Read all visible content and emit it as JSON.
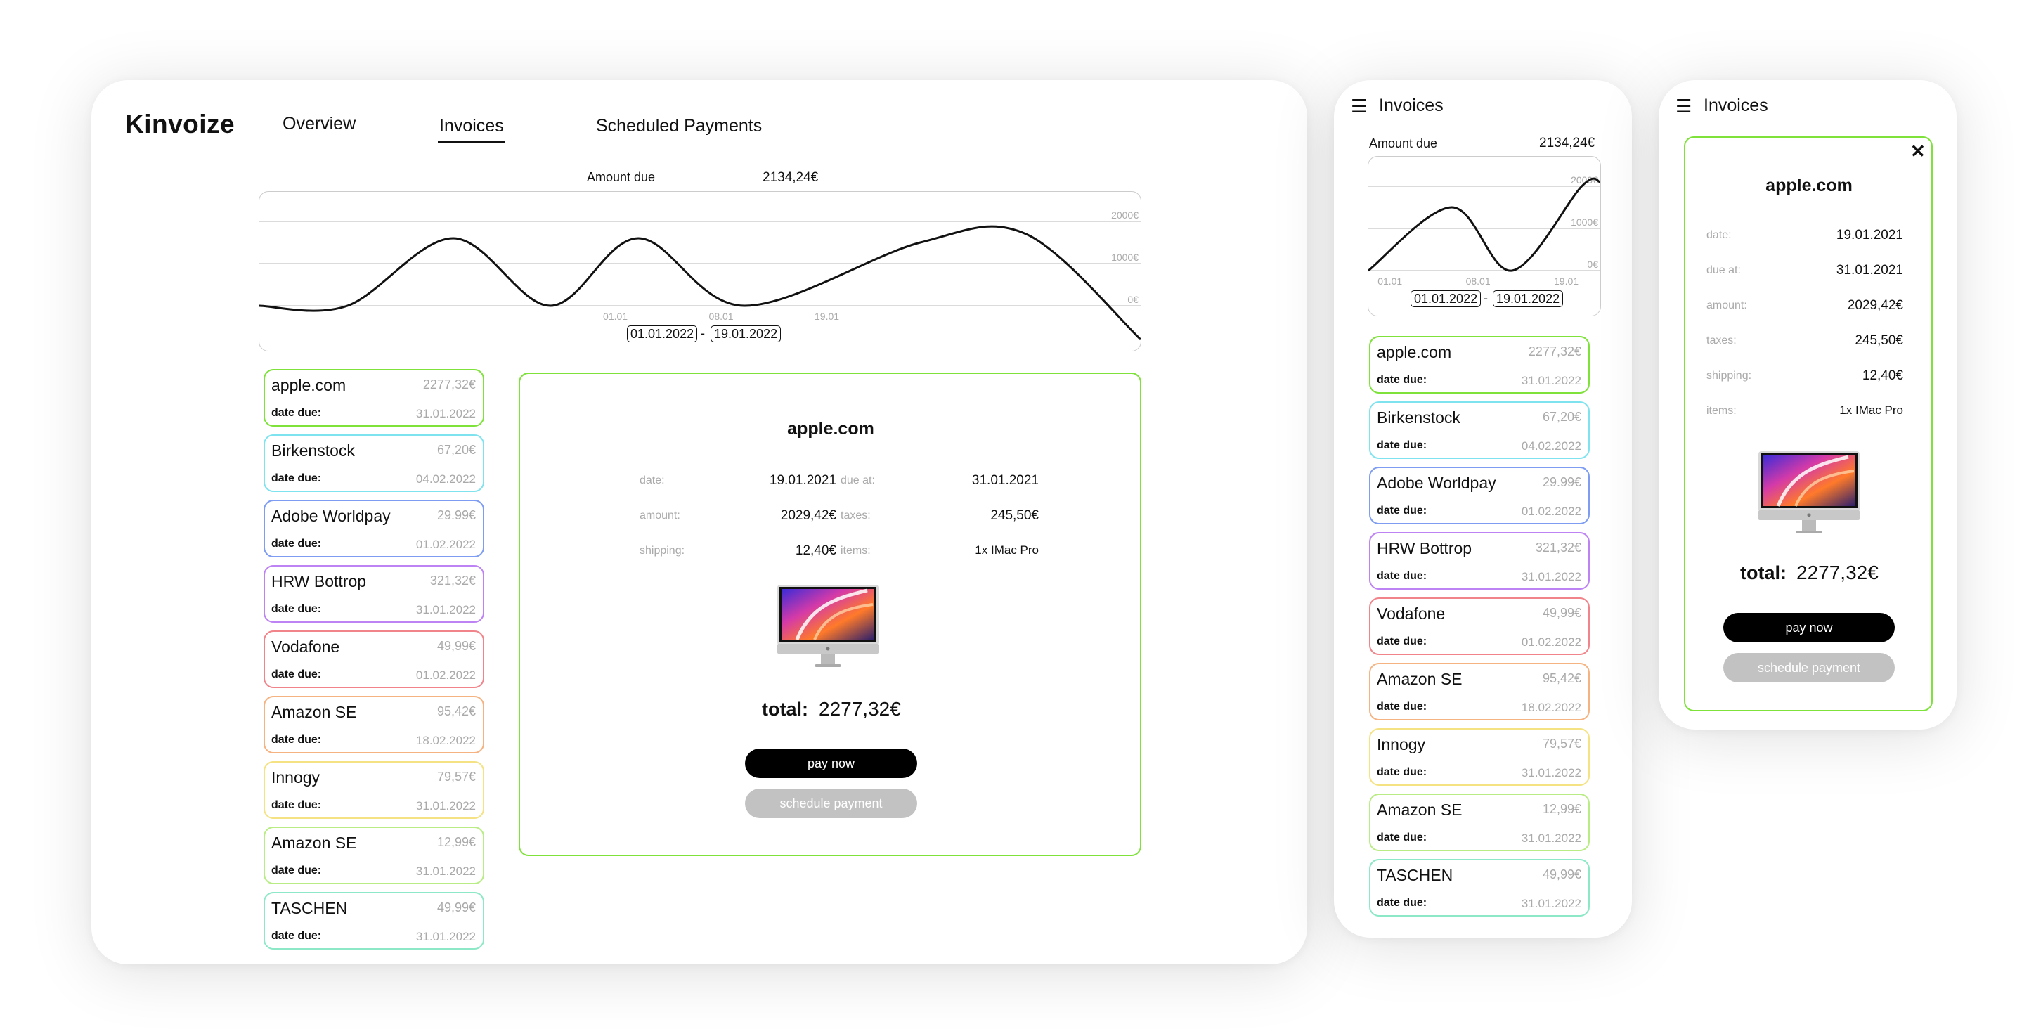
{
  "desktop": {
    "logo": "Kinvoize",
    "nav": [
      {
        "label": "Overview",
        "active": false
      },
      {
        "label": "Invoices",
        "active": true
      },
      {
        "label": "Scheduled Payments",
        "active": false
      }
    ],
    "amount_due_label": "Amount due",
    "amount_due_value": "2134,24€",
    "date_range": {
      "start": "01.01.2022",
      "separator": "-",
      "end": "19.01.2022"
    }
  },
  "chart_data": [
    {
      "type": "line",
      "y_ticks": [
        "2000€",
        "1000€",
        "0€"
      ],
      "x_ticks": [
        "01.01",
        "08.01",
        "19.01"
      ],
      "series": [
        {
          "points": [
            [
              0,
              0
            ],
            [
              0.1,
              0
            ],
            [
              0.22,
              1600
            ],
            [
              0.33,
              0
            ],
            [
              0.43,
              1600
            ],
            [
              0.55,
              0
            ],
            [
              0.75,
              1500
            ],
            [
              0.87,
              1700
            ],
            [
              1,
              -800
            ]
          ]
        }
      ],
      "ylim": [
        0,
        2000
      ],
      "grid": true,
      "line_color": "#111111"
    },
    {
      "type": "line",
      "y_ticks": [
        "2000€",
        "1000€",
        "0€"
      ],
      "x_ticks": [
        "01.01",
        "08.01",
        "19.01"
      ],
      "series": [
        {
          "points": [
            [
              0,
              0
            ],
            [
              0.36,
              1500
            ],
            [
              0.62,
              0
            ],
            [
              0.92,
              2000
            ],
            [
              1,
              2100
            ]
          ]
        }
      ],
      "ylim": [
        0,
        2000
      ],
      "grid": true,
      "line_color": "#111111"
    }
  ],
  "invoices": [
    {
      "name": "apple.com",
      "amount": "2277,32€",
      "date_label": "date due:",
      "date_due": "31.01.2022",
      "color": "#7ee23a"
    },
    {
      "name": "Birkenstock",
      "amount": "67,20€",
      "date_label": "date due:",
      "date_due": "04.02.2022",
      "color": "#7fe3ef"
    },
    {
      "name": "Adobe Worldpay",
      "amount": "29.99€",
      "date_label": "date due:",
      "date_due": "01.02.2022",
      "color": "#7d9cf2"
    },
    {
      "name": "HRW Bottrop",
      "amount": "321,32€",
      "date_label": "date due:",
      "date_due": "31.01.2022",
      "color": "#bd82f4"
    },
    {
      "name": "Vodafone",
      "amount": "49,99€",
      "date_label": "date due:",
      "date_due": "01.02.2022",
      "color": "#f1848a"
    },
    {
      "name": "Amazon SE",
      "amount": "95,42€",
      "date_label": "date due:",
      "date_due": "18.02.2022",
      "color": "#f6b382"
    },
    {
      "name": "Innogy",
      "amount": "79,57€",
      "date_label": "date due:",
      "date_due": "31.01.2022",
      "color": "#f5e283"
    },
    {
      "name": "Amazon SE",
      "amount": "12,99€",
      "date_label": "date due:",
      "date_due": "31.01.2022",
      "color": "#b9ec84"
    },
    {
      "name": "TASCHEN",
      "amount": "49,99€",
      "date_label": "date due:",
      "date_due": "31.01.2022",
      "color": "#8ce8c6"
    }
  ],
  "detail": {
    "merchant": "apple.com",
    "fields": {
      "date": {
        "label": "date:",
        "value": "19.01.2021"
      },
      "due_at": {
        "label": "due at:",
        "value": "31.01.2021"
      },
      "amount": {
        "label": "amount:",
        "value": "2029,42€"
      },
      "taxes": {
        "label": "taxes:",
        "value": "245,50€"
      },
      "shipping": {
        "label": "shipping:",
        "value": "12,40€"
      },
      "items": {
        "label": "items:",
        "value": "1x IMac Pro"
      }
    },
    "total_label": "total:",
    "total_value": "2277,32€",
    "pay_label": "pay now",
    "schedule_label": "schedule payment",
    "border_color": "#7ee23a",
    "product_icon": "imac-icon"
  },
  "tablet": {
    "menu_icon": "hamburger-icon",
    "title": "Invoices"
  },
  "mobile": {
    "menu_icon": "hamburger-icon",
    "title": "Invoices",
    "close_icon": "close-icon",
    "close_glyph": "✕"
  }
}
